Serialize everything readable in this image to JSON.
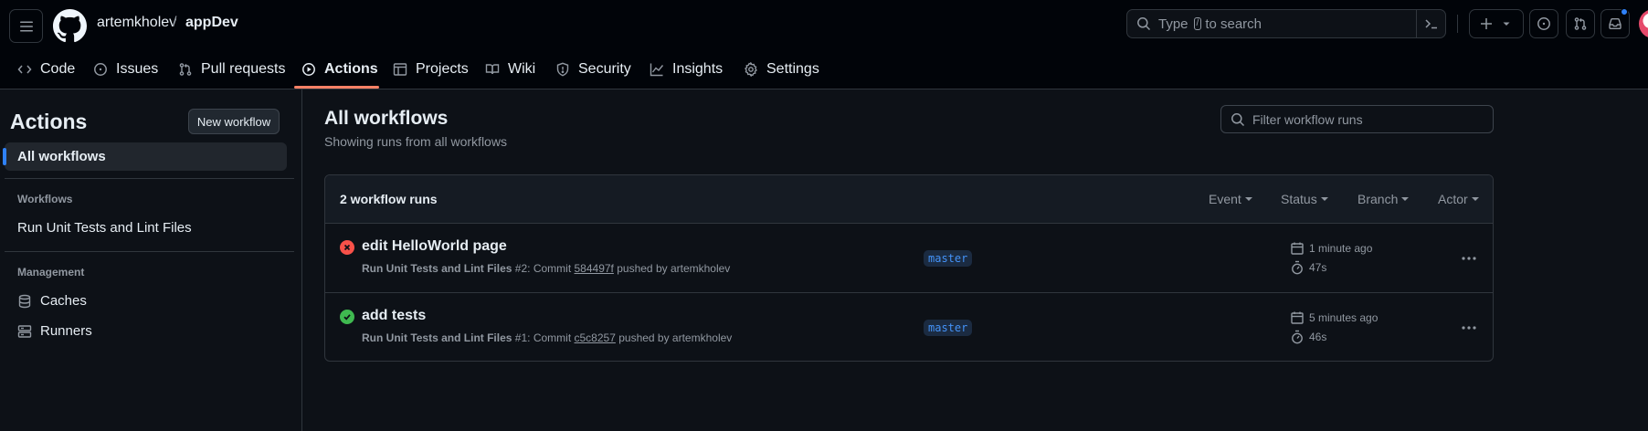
{
  "header": {
    "repo_owner": "artemkholev",
    "separator": "/",
    "repo_name": "appDev",
    "search_text_before": "Type",
    "search_key": "/",
    "search_text_after": "to search"
  },
  "repo_nav": [
    {
      "label": "Code",
      "icon": "code-icon"
    },
    {
      "label": "Issues",
      "icon": "issue-opened-icon"
    },
    {
      "label": "Pull requests",
      "icon": "git-pull-request-icon"
    },
    {
      "label": "Actions",
      "icon": "play-icon",
      "active": true
    },
    {
      "label": "Projects",
      "icon": "table-icon"
    },
    {
      "label": "Wiki",
      "icon": "book-icon"
    },
    {
      "label": "Security",
      "icon": "shield-icon"
    },
    {
      "label": "Insights",
      "icon": "graph-icon"
    },
    {
      "label": "Settings",
      "icon": "gear-icon"
    }
  ],
  "sidebar": {
    "title": "Actions",
    "new_workflow": "New workflow",
    "all_workflows": "All workflows",
    "workflows_heading": "Workflows",
    "workflows": [
      {
        "label": "Run Unit Tests and Lint Files"
      }
    ],
    "management_heading": "Management",
    "management": [
      {
        "label": "Caches",
        "icon": "database-icon"
      },
      {
        "label": "Runners",
        "icon": "server-icon"
      }
    ]
  },
  "main": {
    "title": "All workflows",
    "subtitle": "Showing runs from all workflows",
    "filter_placeholder": "Filter workflow runs",
    "runs_count": "2 workflow runs",
    "filters": [
      "Event",
      "Status",
      "Branch",
      "Actor"
    ],
    "runs": [
      {
        "status": "failure",
        "title": "edit HelloWorld page",
        "workflow": "Run Unit Tests and Lint Files",
        "number": "#2",
        "commit_prefix": ": Commit",
        "sha": "584497f",
        "pushed_by": "pushed by artemkholev",
        "branch": "master",
        "time": "1 minute ago",
        "duration": "47s"
      },
      {
        "status": "success",
        "title": "add tests",
        "workflow": "Run Unit Tests and Lint Files",
        "number": "#1",
        "commit_prefix": ": Commit",
        "sha": "c5c8257",
        "pushed_by": "pushed by artemkholev",
        "branch": "master",
        "time": "5 minutes ago",
        "duration": "46s"
      }
    ]
  },
  "colors": {
    "background": "#0d1117",
    "header_bg": "#010409",
    "accent_underline": "#f78166",
    "failure": "#f85149",
    "success": "#3fb950",
    "link_blue": "#4493f8"
  }
}
